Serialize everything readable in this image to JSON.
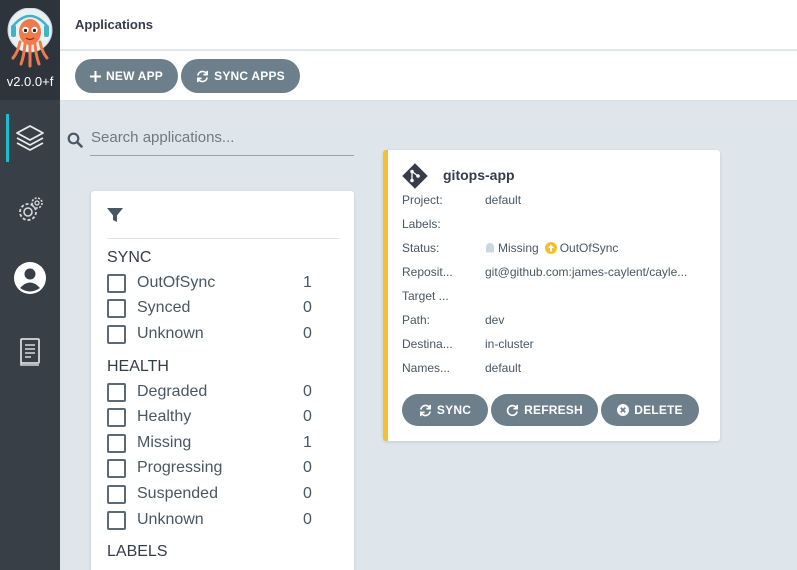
{
  "app": {
    "version": "v2.0.0+f"
  },
  "nav": [
    {
      "icon": "layers-icon",
      "label": "Applications"
    },
    {
      "icon": "settings-icon",
      "label": "Settings"
    },
    {
      "icon": "user-icon",
      "label": "User Info"
    },
    {
      "icon": "docs-icon",
      "label": "Documentation"
    }
  ],
  "header": {
    "title": "Applications"
  },
  "toolbar": {
    "new_app": "NEW APP",
    "sync_apps": "SYNC APPS"
  },
  "search": {
    "placeholder": "Search applications..."
  },
  "filters": {
    "sync_title": "SYNC",
    "sync": [
      {
        "label": "OutOfSync",
        "count": "1"
      },
      {
        "label": "Synced",
        "count": "0"
      },
      {
        "label": "Unknown",
        "count": "0"
      }
    ],
    "health_title": "HEALTH",
    "health": [
      {
        "label": "Degraded",
        "count": "0"
      },
      {
        "label": "Healthy",
        "count": "0"
      },
      {
        "label": "Missing",
        "count": "1"
      },
      {
        "label": "Progressing",
        "count": "0"
      },
      {
        "label": "Suspended",
        "count": "0"
      },
      {
        "label": "Unknown",
        "count": "0"
      }
    ],
    "labels_title": "LABELS"
  },
  "tile": {
    "name": "gitops-app",
    "rows": [
      {
        "key": "Project:",
        "value": "default"
      },
      {
        "key": "Labels:",
        "value": ""
      },
      {
        "key": "Status:",
        "value": ""
      },
      {
        "key": "Reposit...",
        "value": "git@github.com:james-caylent/cayle..."
      },
      {
        "key": "Target ...",
        "value": ""
      },
      {
        "key": "Path:",
        "value": "dev"
      },
      {
        "key": "Destina...",
        "value": "in-cluster"
      },
      {
        "key": "Names...",
        "value": "default"
      }
    ],
    "status": {
      "health": "Missing",
      "sync": "OutOfSync"
    },
    "buttons": {
      "sync": "SYNC",
      "refresh": "REFRESH",
      "delete": "DELETE"
    }
  },
  "colors": {
    "accent": "#18bed4",
    "warning": "#f4c030",
    "button": "#6d7f8b",
    "nav": "#383f47"
  }
}
